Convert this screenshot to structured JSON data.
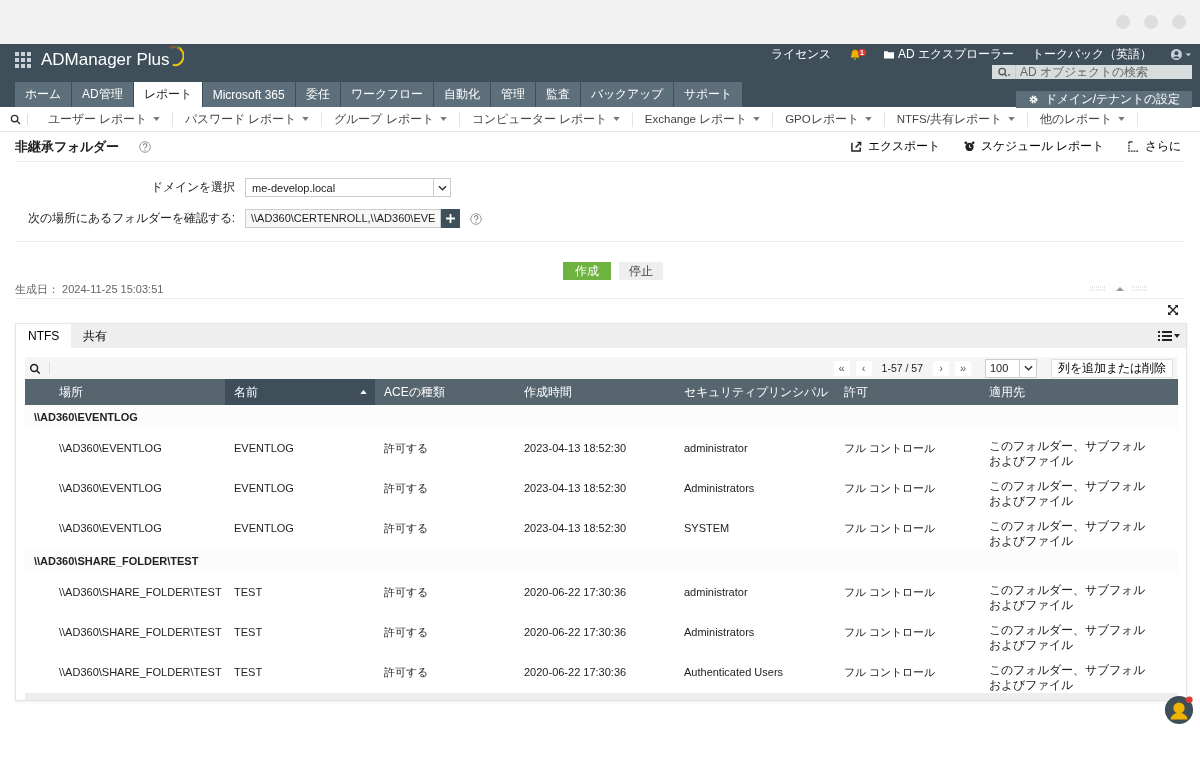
{
  "header": {
    "app_name": "ADManager Plus",
    "links": [
      {
        "kind": "text",
        "label": "ライセンス"
      },
      {
        "kind": "bell",
        "label": "1"
      },
      {
        "kind": "folder",
        "label": "AD エクスプローラー"
      },
      {
        "kind": "text",
        "label": "トークバック（英語）"
      }
    ],
    "search": {
      "placeholder": "AD オブジェクトの検索"
    },
    "tabs": [
      {
        "label": "ホーム",
        "selected": false
      },
      {
        "label": "AD管理",
        "selected": false
      },
      {
        "label": "レポート",
        "selected": true
      },
      {
        "label": "Microsoft 365",
        "selected": false
      },
      {
        "label": "委任",
        "selected": false
      },
      {
        "label": "ワークフロー",
        "selected": false
      },
      {
        "label": "自動化",
        "selected": false
      },
      {
        "label": "管理",
        "selected": false
      },
      {
        "label": "監査",
        "selected": false
      },
      {
        "label": "バックアップ",
        "selected": false
      },
      {
        "label": "サポート",
        "selected": false
      }
    ],
    "settings_button": "ドメイン/テナントの設定"
  },
  "subnav": [
    "ユーザー レポート",
    "パスワード レポート",
    "グループ レポート",
    "コンピューター レポート",
    "Exchange レポート",
    "GPOレポート",
    "NTFS/共有レポート",
    "他のレポート"
  ],
  "page": {
    "title": "非継承フォルダー",
    "actions": [
      {
        "kind": "export",
        "label": "エクスポート"
      },
      {
        "kind": "schedule",
        "label": "スケジュール レポート"
      },
      {
        "kind": "more",
        "label": "さらに"
      }
    ]
  },
  "form": {
    "domain_label": "ドメインを選択",
    "domain_value": "me-develop.local",
    "folders_label": "次の場所にあるフォルダーを確認する:",
    "folders_value": "\\\\AD360\\CERTENROLL,\\\\AD360\\EVE"
  },
  "buttons": {
    "generate": "作成",
    "stop": "停止"
  },
  "generated": {
    "label": "生成日：",
    "value": "2024-11-25 15:03:51"
  },
  "report_tabs": [
    {
      "label": "NTFS",
      "selected": true
    },
    {
      "label": "共有",
      "selected": false
    }
  ],
  "pagination": {
    "first": "«",
    "prev": "‹",
    "range": "1-57 / 57",
    "next": "›",
    "last": "»",
    "page_size": "100",
    "columns_button": "列を追加または削除"
  },
  "table": {
    "columns": [
      {
        "label": "場所",
        "sorted": false
      },
      {
        "label": "名前",
        "sorted": true
      },
      {
        "label": "ACEの種類",
        "sorted": false
      },
      {
        "label": "作成時間",
        "sorted": false
      },
      {
        "label": "セキュリティプリンシパル",
        "sorted": false
      },
      {
        "label": "許可",
        "sorted": false
      },
      {
        "label": "適用先",
        "sorted": false
      }
    ],
    "groups": [
      {
        "title": "\\\\AD360\\EVENTLOG",
        "rows": [
          {
            "cells": [
              "\\\\AD360\\EVENTLOG",
              "EVENTLOG",
              "許可する",
              "2023-04-13 18:52:30",
              "administrator",
              "フル コントロール"
            ],
            "applies_to": [
              "このフォルダー、サブフォル",
              "およびファイル"
            ]
          },
          {
            "cells": [
              "\\\\AD360\\EVENTLOG",
              "EVENTLOG",
              "許可する",
              "2023-04-13 18:52:30",
              "Administrators",
              "フル コントロール"
            ],
            "applies_to": [
              "このフォルダー、サブフォル",
              "およびファイル"
            ]
          },
          {
            "cells": [
              "\\\\AD360\\EVENTLOG",
              "EVENTLOG",
              "許可する",
              "2023-04-13 18:52:30",
              "SYSTEM",
              "フル コントロール"
            ],
            "applies_to": [
              "このフォルダー、サブフォル",
              "およびファイル"
            ]
          }
        ]
      },
      {
        "title": "\\\\AD360\\SHARE_FOLDER\\TEST",
        "rows": [
          {
            "cells": [
              "\\\\AD360\\SHARE_FOLDER\\TEST",
              "TEST",
              "許可する",
              "2020-06-22 17:30:36",
              "administrator",
              "フル コントロール"
            ],
            "applies_to": [
              "このフォルダー、サブフォル",
              "およびファイル"
            ]
          },
          {
            "cells": [
              "\\\\AD360\\SHARE_FOLDER\\TEST",
              "TEST",
              "許可する",
              "2020-06-22 17:30:36",
              "Administrators",
              "フル コントロール"
            ],
            "applies_to": [
              "このフォルダー、サブフォル",
              "およびファイル"
            ]
          },
          {
            "cells": [
              "\\\\AD360\\SHARE_FOLDER\\TEST",
              "TEST",
              "許可する",
              "2020-06-22 17:30:36",
              "Authenticated Users",
              "フル コントロール"
            ],
            "applies_to": [
              "このフォルダー、サブフォル",
              "およびファイル"
            ]
          }
        ]
      }
    ]
  }
}
